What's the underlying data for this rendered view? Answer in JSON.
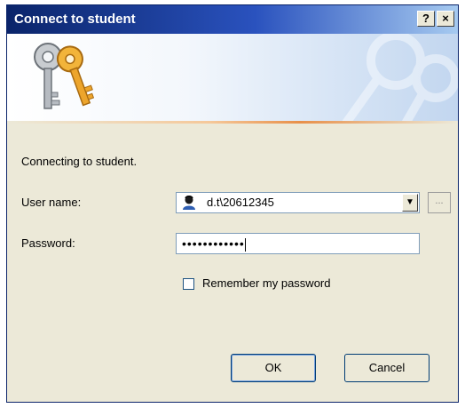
{
  "window": {
    "title": "Connect to student",
    "help_label": "?",
    "close_label": "×"
  },
  "message": "Connecting to student.",
  "form": {
    "username_label": "User name:",
    "username_value": "d.t\\20612345",
    "browse_label": "...",
    "password_label": "Password:",
    "password_value": "••••••••••••",
    "remember_label": "Remember my password",
    "remember_checked": false
  },
  "buttons": {
    "ok_label": "OK",
    "cancel_label": "Cancel"
  },
  "icons": {
    "banner": "keys-icon",
    "user": "user-icon",
    "dropdown": "chevron-down-icon"
  },
  "colors": {
    "titlebar_start": "#0a246a",
    "titlebar_end": "#a6caf0",
    "dialog_bg": "#ece9d8",
    "accent_line": "#e8904a"
  }
}
